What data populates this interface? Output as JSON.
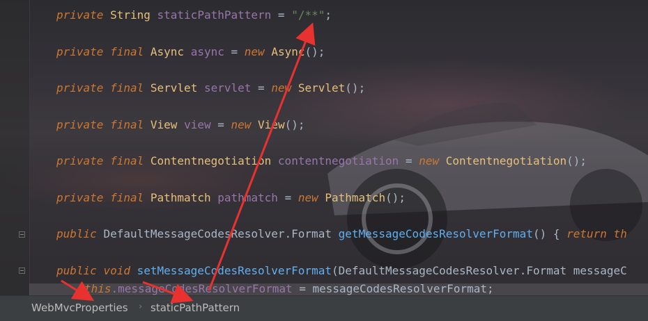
{
  "code_lines": [
    {
      "mod": "private",
      "type": "String",
      "name": "staticPathPattern",
      "op": " = ",
      "value": "\"/**\"",
      "end": ";"
    },
    {
      "mod": "private",
      "final": "final",
      "type": "Async",
      "name": "async",
      "op": " = ",
      "new": "new",
      "ctor": "Async",
      "end": "();"
    },
    {
      "mod": "private",
      "final": "final",
      "type": "Servlet",
      "name": "servlet",
      "op": " = ",
      "new": "new",
      "ctor": "Servlet",
      "end": "();"
    },
    {
      "mod": "private",
      "final": "final",
      "type": "View",
      "name": "view",
      "op": " = ",
      "new": "new",
      "ctor": "View",
      "end": "();"
    },
    {
      "mod": "private",
      "final": "final",
      "type": "Contentnegotiation",
      "name": "contentnegotiation",
      "op": " = ",
      "new": "new",
      "ctor": "Contentnegotiation",
      "end": "();"
    },
    {
      "mod": "private",
      "final": "final",
      "type": "Pathmatch",
      "name": "pathmatch",
      "op": " = ",
      "new": "new",
      "ctor": "Pathmatch",
      "end": "();"
    },
    {
      "mod": "public",
      "type": "DefaultMessageCodesResolver.Format",
      "method": "getMessageCodesResolverFormat",
      "rest": "() { ",
      "ret": "return th"
    },
    {
      "mod": "public",
      "void": "void",
      "method": "setMessageCodesResolverFormat",
      "rest": "(DefaultMessageCodesResolver.Format messageC"
    },
    {
      "this": "this",
      "field": ".messageCodesResolverFormat",
      "rest": " = messageCodesResolverFormat;"
    }
  ],
  "breadcrumb": {
    "class_name": "WebMvcProperties",
    "separator": "›",
    "field_name": "staticPathPattern"
  },
  "colors": {
    "keyword": "#cc7832",
    "field": "#9876aa",
    "string": "#6a8759",
    "method": "#61afef",
    "annotation_arrow": "#e8322f"
  },
  "icons": [
    "fold-icon",
    "fold-icon"
  ]
}
